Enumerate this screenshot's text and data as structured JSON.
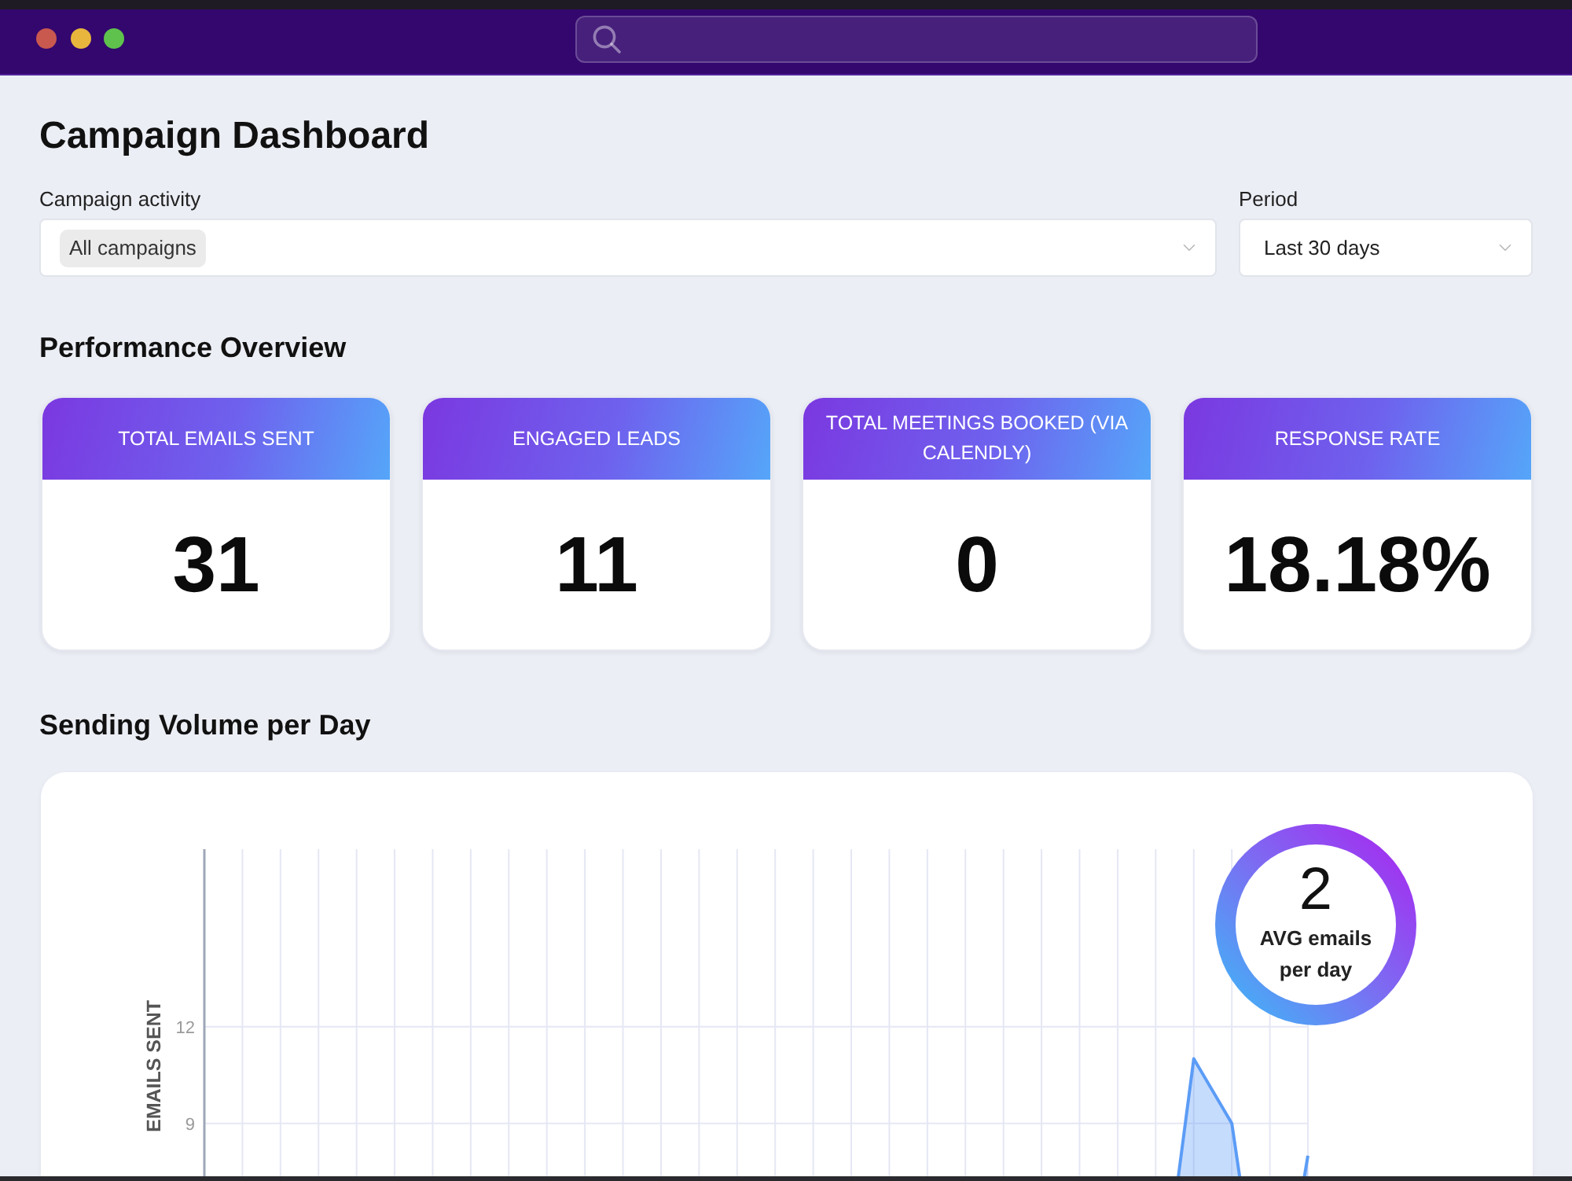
{
  "title": "Campaign Dashboard",
  "filters": [
    {
      "kind": "multi",
      "label": "Campaign activity",
      "chips": [
        "All campaigns"
      ]
    },
    {
      "kind": "single",
      "label": "Period",
      "value": "Last 30 days"
    }
  ],
  "performance": {
    "heading": "Performance Overview",
    "cards": [
      {
        "label": "TOTAL EMAILS SENT",
        "value": "31"
      },
      {
        "label": "ENGAGED LEADS",
        "value": "11"
      },
      {
        "label": "TOTAL MEETINGS BOOKED (VIA CALENDLY)",
        "value": "0"
      },
      {
        "label": "RESPONSE RATE",
        "value": "18.18%"
      }
    ]
  },
  "volume": {
    "heading": "Sending Volume per Day",
    "average": {
      "value": "2",
      "label": "AVG emails per day"
    },
    "chart_data": {
      "type": "area",
      "ylabel": "EMAILS SENT",
      "categories": [
        null,
        null,
        null,
        null,
        null,
        null,
        null,
        null,
        null,
        null,
        null,
        null,
        null,
        null,
        null,
        null,
        null,
        null,
        null,
        null,
        null,
        null,
        null,
        null,
        null,
        null,
        null,
        null,
        null,
        null
      ],
      "ylim": [
        0,
        17.5
      ],
      "yticks": [
        9,
        12
      ],
      "series": [
        {
          "color": "#5b9cf6",
          "values": [
            0,
            0,
            0,
            0,
            0,
            0,
            0,
            0,
            0,
            0,
            0,
            0,
            0,
            0,
            0,
            0,
            0,
            0,
            0,
            0,
            0,
            0,
            0,
            0,
            0,
            2,
            11,
            9,
            1,
            8
          ]
        }
      ]
    }
  }
}
